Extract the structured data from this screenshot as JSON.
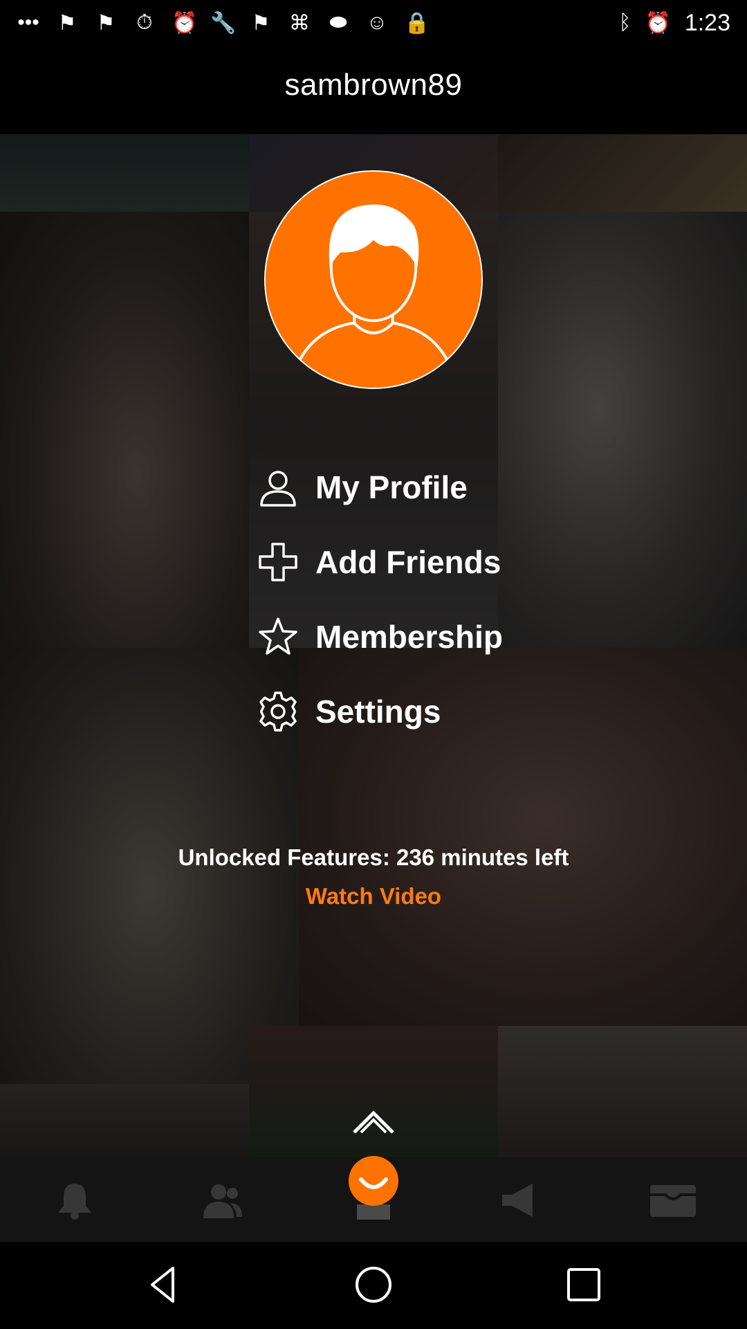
{
  "status_bar": {
    "time": "1:23",
    "icons": [
      "more-icon",
      "fantasy-icon",
      "fantasy-icon",
      "timer-icon",
      "alarm-icon",
      "wrench-icon",
      "fantasy-icon",
      "jet-icon",
      "fox-sports-icon",
      "smile-icon",
      "lock-icon",
      "bluetooth-icon",
      "alarm-icon"
    ]
  },
  "header": {
    "username": "sambrown89"
  },
  "menu": {
    "items": [
      {
        "label": "My Profile",
        "icon": "person-icon"
      },
      {
        "label": "Add Friends",
        "icon": "plus-icon"
      },
      {
        "label": "Membership",
        "icon": "star-icon"
      },
      {
        "label": "Settings",
        "icon": "gear-icon"
      }
    ]
  },
  "unlock": {
    "text": "Unlocked Features: 236 minutes left",
    "watch_video": "Watch Video"
  },
  "colors": {
    "accent": "#ff7200",
    "link": "#ff7a12",
    "background": "#000000"
  },
  "bottom_bar": {
    "tabs": [
      "notifications-icon",
      "friends-icon",
      "home-icon",
      "megaphone-icon",
      "inbox-icon"
    ]
  },
  "nav": [
    "back-icon",
    "home-circle-icon",
    "recents-icon"
  ]
}
